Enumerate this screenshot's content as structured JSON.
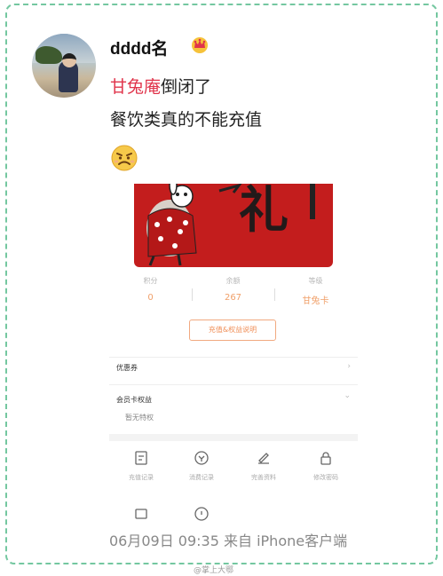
{
  "post": {
    "username": "dddd名",
    "mention": "甘兔庵",
    "text_after_mention": "倒闭了",
    "text_line2": "餐饮类真的不能充值",
    "timestamp": "06月09日 09:35  来自 iPhone客户端",
    "badge_icon": "crown-icon",
    "emoji_icon": "angry-face-emoji"
  },
  "embedded_screenshot": {
    "card_character": "礼",
    "stats": [
      {
        "label": "积分",
        "value": "0"
      },
      {
        "label": "余额",
        "value": "267"
      },
      {
        "label": "等级",
        "value": "甘兔卡"
      }
    ],
    "rules_button": "充值&权益说明",
    "rows": [
      {
        "label": "优惠券",
        "arrow": "›"
      },
      {
        "label": "会员卡权益",
        "arrow": "⌄",
        "sub": "暂无特权"
      }
    ],
    "icons": [
      {
        "name": "recharge-record-icon",
        "label": "充值记录"
      },
      {
        "name": "consume-record-icon",
        "label": "消费记录"
      },
      {
        "name": "edit-profile-icon",
        "label": "完善资料"
      },
      {
        "name": "change-password-icon",
        "label": "修改密码"
      },
      {
        "name": "card-icon",
        "label": ""
      },
      {
        "name": "info-icon",
        "label": ""
      }
    ]
  },
  "footer": {
    "watermark": "@掌上大鄂"
  },
  "colors": {
    "mention": "#e0344b",
    "frame_border": "#74c7a0",
    "card_red": "#c31d1d",
    "accent_orange": "#f08f58"
  }
}
